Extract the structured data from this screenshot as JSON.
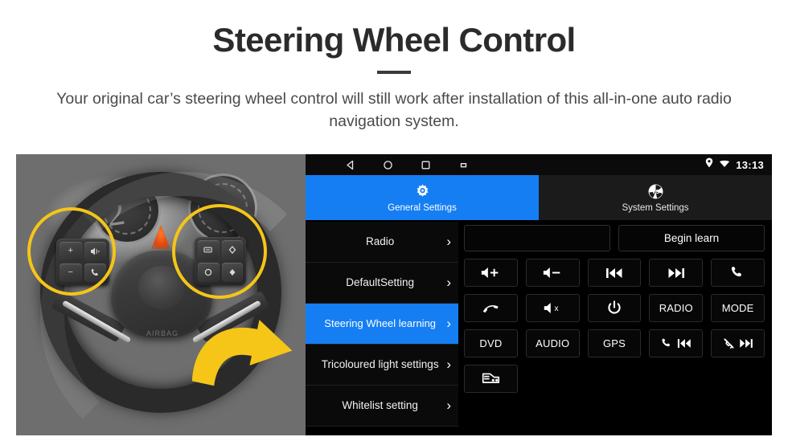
{
  "header": {
    "title": "Steering Wheel Control",
    "subtitle": "Your original car’s steering wheel control will still work after installation of this all-in-one auto radio navigation system."
  },
  "photo": {
    "alt_name": "steering-wheel-photo",
    "highlight_color": "#F5C518",
    "arrow_color": "#F5C518",
    "airbag_text": "AIRBAG",
    "gauge_digit": "2"
  },
  "unit": {
    "statusbar": {
      "nav_icons": [
        "back-icon",
        "home-icon",
        "recents-icon",
        "screenshot-icon"
      ],
      "status_icons": [
        "location-pin-icon",
        "wifi-icon"
      ],
      "time": "13:13"
    },
    "tabs": [
      {
        "label": "General Settings",
        "icon": "gear-icon",
        "active": true
      },
      {
        "label": "System Settings",
        "icon": "app-logo-icon",
        "active": false
      }
    ],
    "sidebar": {
      "items": [
        {
          "label": "Radio",
          "active": false
        },
        {
          "label": "DefaultSetting",
          "active": false
        },
        {
          "label": "Steering Wheel learning",
          "active": true
        },
        {
          "label": "Tricoloured light settings",
          "active": false
        },
        {
          "label": "Whitelist setting",
          "active": false
        }
      ],
      "chevron": "›"
    },
    "panel": {
      "learn_field_value": "",
      "learn_field_placeholder": "",
      "begin_learn_label": "Begin learn",
      "buttons": [
        {
          "name": "volume-up-button",
          "icon": "volume-up-icon",
          "label": ""
        },
        {
          "name": "volume-down-button",
          "icon": "volume-down-icon",
          "label": ""
        },
        {
          "name": "previous-track-button",
          "icon": "previous-track-icon",
          "label": ""
        },
        {
          "name": "next-track-button",
          "icon": "next-track-icon",
          "label": ""
        },
        {
          "name": "call-answer-button",
          "icon": "phone-icon",
          "label": ""
        },
        {
          "name": "call-hangup-button",
          "icon": "phone-hangup-icon",
          "label": ""
        },
        {
          "name": "mute-button",
          "icon": "volume-mute-icon",
          "label": ""
        },
        {
          "name": "power-button",
          "icon": "power-icon",
          "label": ""
        },
        {
          "name": "radio-button",
          "icon": "",
          "label": "RADIO"
        },
        {
          "name": "mode-button",
          "icon": "",
          "label": "MODE"
        },
        {
          "name": "dvd-button",
          "icon": "",
          "label": "DVD"
        },
        {
          "name": "audio-button",
          "icon": "",
          "label": "AUDIO"
        },
        {
          "name": "gps-button",
          "icon": "",
          "label": "GPS"
        },
        {
          "name": "call-previous-button",
          "icon": "phone-previous-icon",
          "label": ""
        },
        {
          "name": "hangup-next-button",
          "icon": "hangup-next-icon",
          "label": ""
        },
        {
          "name": "car-settings-button",
          "icon": "car-icon",
          "label": ""
        }
      ]
    },
    "colors": {
      "accent_blue": "#157EF3",
      "background": "#000000",
      "text": "#FFFFFF"
    }
  }
}
